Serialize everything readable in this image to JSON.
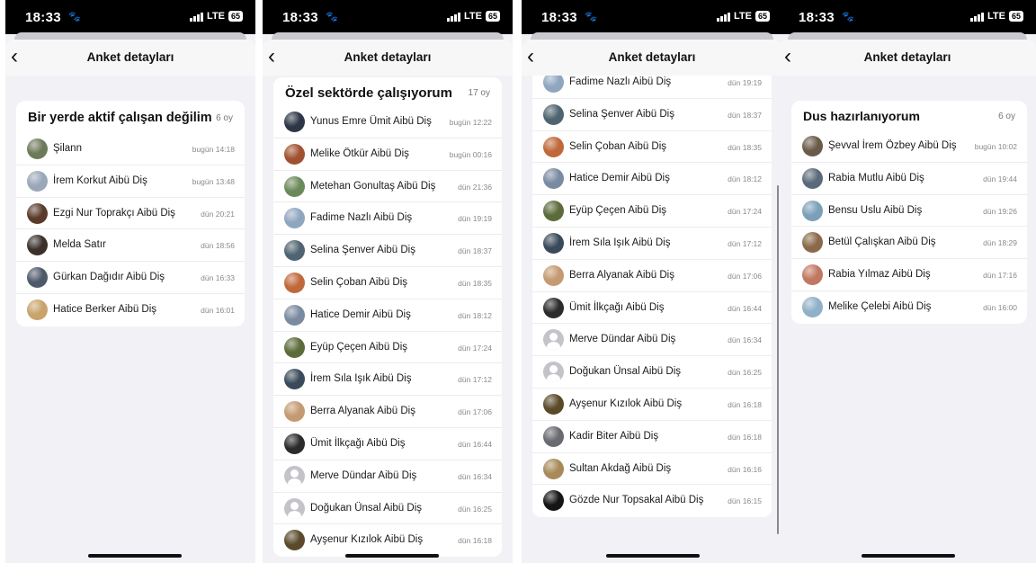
{
  "panels": [
    {
      "status": {
        "time": "18:33",
        "lte": "LTE",
        "battery": "65"
      },
      "nav": {
        "back": "‹",
        "title": "Anket detayları"
      },
      "card": {
        "title": "Bir yerde aktif çalışan değilim",
        "count": "6 oy",
        "rows": [
          {
            "name": "Şilann",
            "time": "bugün 14:18",
            "avatar": "#6d7a5a"
          },
          {
            "name": "İrem Korkut Aibü Diş",
            "time": "bugün 13:48",
            "avatar": "#9aa7b8"
          },
          {
            "name": "Ezgi Nur Toprakçı Aibü Diş",
            "time": "dün 20:21",
            "avatar": "#5a3b2b"
          },
          {
            "name": "Melda Satır",
            "time": "dün 18:56",
            "avatar": "#3b302a"
          },
          {
            "name": "Gürkan Dağıdır Aibü Diş",
            "time": "dün 16:33",
            "avatar": "#4e5a6a"
          },
          {
            "name": "Hatice Berker Aibü Diş",
            "time": "dün 16:01",
            "avatar": "#c8a36c"
          }
        ]
      }
    },
    {
      "status": {
        "time": "18:33",
        "lte": "LTE",
        "battery": "65"
      },
      "nav": {
        "back": "‹",
        "title": "Anket detayları"
      },
      "card": {
        "title": "Özel sektörde çalışıyorum",
        "count": "17 oy",
        "rows": [
          {
            "name": "Yunus Emre Ümit Aibü Diş",
            "time": "bugün 12:22",
            "avatar": "#2d3646"
          },
          {
            "name": "Melike Ötkür Aibü Diş",
            "time": "bugün 00:16",
            "avatar": "#a0512f"
          },
          {
            "name": "Metehan Gonultaş Aibü Diş",
            "time": "dün 21:36",
            "avatar": "#6b8a5a"
          },
          {
            "name": "Fadime Nazlı Aibü Diş",
            "time": "dün 19:19",
            "avatar": "#8fa6bf"
          },
          {
            "name": "Selina Şenver Aibü Diş",
            "time": "dün 18:37",
            "avatar": "#4f6470"
          },
          {
            "name": "Selin Çoban Aibü Diş",
            "time": "dün 18:35",
            "avatar": "#c0683a"
          },
          {
            "name": "Hatice Demir Aibü Diş",
            "time": "dün 18:12",
            "avatar": "#7a8aa0"
          },
          {
            "name": "Eyüp Çeçen Aibü Diş",
            "time": "dün 17:24",
            "avatar": "#5b6b3a"
          },
          {
            "name": "İrem Sıla Işık Aibü Diş",
            "time": "dün 17:12",
            "avatar": "#3a4a5a"
          },
          {
            "name": "Berra Alyanak Aibü Diş",
            "time": "dün 17:06",
            "avatar": "#c49a72"
          },
          {
            "name": "Ümit İlkçağı Aibü Diş",
            "time": "dün 16:44",
            "avatar": "#2b2b2b"
          },
          {
            "name": "Merve Dündar Aibü Diş",
            "time": "dün 16:34",
            "avatar": "placeholder"
          },
          {
            "name": "Doğukan Ünsal Aibü Diş",
            "time": "dün 16:25",
            "avatar": "placeholder"
          },
          {
            "name": "Ayşenur Kızılok Aibü Diş",
            "time": "dün 16:18",
            "avatar": "#5a4a2a"
          }
        ]
      }
    },
    {
      "status": {
        "time": "18:33",
        "lte": "LTE",
        "battery": "65"
      },
      "nav": {
        "back": "‹",
        "title": "Anket detayları"
      },
      "card": {
        "title": "",
        "count": "",
        "rows": [
          {
            "name": "Fadime Nazlı Aibü Diş",
            "time": "dün 19:19",
            "avatar": "#8fa6bf"
          },
          {
            "name": "Selina Şenver Aibü Diş",
            "time": "dün 18:37",
            "avatar": "#4f6470"
          },
          {
            "name": "Selin Çoban Aibü Diş",
            "time": "dün 18:35",
            "avatar": "#c0683a"
          },
          {
            "name": "Hatice Demir Aibü Diş",
            "time": "dün 18:12",
            "avatar": "#7a8aa0"
          },
          {
            "name": "Eyüp Çeçen Aibü Diş",
            "time": "dün 17:24",
            "avatar": "#5b6b3a"
          },
          {
            "name": "İrem Sıla Işık Aibü Diş",
            "time": "dün 17:12",
            "avatar": "#3a4a5a"
          },
          {
            "name": "Berra Alyanak Aibü Diş",
            "time": "dün 17:06",
            "avatar": "#c49a72"
          },
          {
            "name": "Ümit İlkçağı Aibü Diş",
            "time": "dün 16:44",
            "avatar": "#2b2b2b"
          },
          {
            "name": "Merve Dündar Aibü Diş",
            "time": "dün 16:34",
            "avatar": "placeholder"
          },
          {
            "name": "Doğukan Ünsal Aibü Diş",
            "time": "dün 16:25",
            "avatar": "placeholder"
          },
          {
            "name": "Ayşenur Kızılok Aibü Diş",
            "time": "dün 16:18",
            "avatar": "#5a4a2a"
          },
          {
            "name": "Kadir Biter Aibü Diş",
            "time": "dün 16:18",
            "avatar": "#6a6a72"
          },
          {
            "name": "Sultan Akdağ Aibü Diş",
            "time": "dün 16:16",
            "avatar": "#a88a5a"
          },
          {
            "name": "Gözde Nur Topsakal Aibü Diş",
            "time": "dün 16:15",
            "avatar": "#151515"
          }
        ]
      }
    },
    {
      "status": {
        "time": "18:33",
        "lte": "LTE",
        "battery": "65"
      },
      "nav": {
        "back": "‹",
        "title": "Anket detayları"
      },
      "card": {
        "title": "Dus hazırlanıyorum",
        "count": "6 oy",
        "rows": [
          {
            "name": "Şevval İrem Özbey Aibü Diş",
            "time": "bugün 10:02",
            "avatar": "#6a5a4a"
          },
          {
            "name": "Rabia Mutlu Aibü Diş",
            "time": "dün 19:44",
            "avatar": "#5a6a7a"
          },
          {
            "name": "Bensu Uslu Aibü Diş",
            "time": "dün 19:26",
            "avatar": "#7aa0b8"
          },
          {
            "name": "Betül Çalışkan Aibü Diş",
            "time": "dün 18:29",
            "avatar": "#8a6a4a"
          },
          {
            "name": "Rabia Yılmaz Aibü Diş",
            "time": "dün 17:16",
            "avatar": "#c07860"
          },
          {
            "name": "Melike Çelebi Aibü Diş",
            "time": "dün 16:00",
            "avatar": "#8fb0c8"
          }
        ]
      }
    }
  ]
}
